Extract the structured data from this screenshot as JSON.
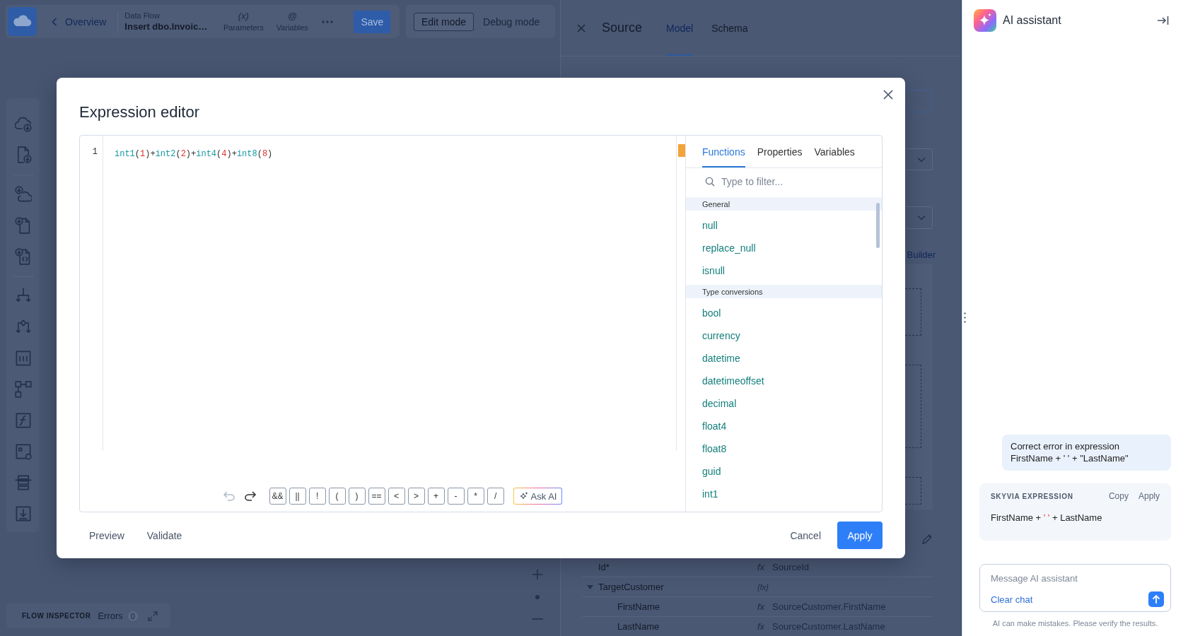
{
  "top_bar": {
    "back_link": "Overview",
    "flow_type": "Data Flow",
    "flow_name": "Insert dbo.Invoic…",
    "tools": [
      {
        "glyph": "(x)",
        "label": "Parameters"
      },
      {
        "glyph": "@",
        "label": "Variables"
      }
    ],
    "save_button": "Save",
    "modes": [
      {
        "label": "Edit mode",
        "selected": true
      },
      {
        "label": "Debug mode",
        "selected": false
      }
    ]
  },
  "flow_inspector": {
    "title": "FLOW INSPECTOR",
    "errors_label": "Errors",
    "errors_count": "0"
  },
  "source_panel": {
    "title": "Source",
    "tabs": [
      {
        "label": "Model",
        "selected": true
      },
      {
        "label": "Schema",
        "selected": false
      }
    ],
    "builder_link": "Builder",
    "mappings": [
      {
        "kind": "field",
        "name": "Id*",
        "marker": "fx",
        "expression": "SourceId"
      },
      {
        "kind": "group",
        "name": "TargetCustomer",
        "marker": "{fx}",
        "expanded": true,
        "children": [
          {
            "kind": "field",
            "name": "FirstName",
            "marker": "fx",
            "expression": "SourceCustomer.FirstName"
          },
          {
            "kind": "field",
            "name": "LastName",
            "marker": "fx",
            "expression": "SourceCustomer.LastName"
          }
        ]
      }
    ]
  },
  "expression_editor": {
    "title": "Expression editor",
    "line_numbers": [
      "1"
    ],
    "code_tokens": [
      {
        "kind": "function",
        "text": "int1"
      },
      {
        "kind": "paren",
        "text": "("
      },
      {
        "kind": "number",
        "text": "1"
      },
      {
        "kind": "paren",
        "text": ")"
      },
      {
        "kind": "operator",
        "text": "+"
      },
      {
        "kind": "function",
        "text": "int2"
      },
      {
        "kind": "paren",
        "text": "("
      },
      {
        "kind": "number",
        "text": "2"
      },
      {
        "kind": "paren",
        "text": ")"
      },
      {
        "kind": "operator",
        "text": "+"
      },
      {
        "kind": "function",
        "text": "int4"
      },
      {
        "kind": "paren",
        "text": "("
      },
      {
        "kind": "number",
        "text": "4"
      },
      {
        "kind": "paren",
        "text": ")"
      },
      {
        "kind": "operator",
        "text": "+"
      },
      {
        "kind": "function",
        "text": "int8"
      },
      {
        "kind": "paren",
        "text": "("
      },
      {
        "kind": "number",
        "text": "8"
      },
      {
        "kind": "paren",
        "text": ")"
      }
    ],
    "history": [
      {
        "kind": "undo",
        "disabled": true
      },
      {
        "kind": "redo",
        "disabled": false
      }
    ],
    "operators": [
      "&&",
      "||",
      "!",
      "(",
      ")",
      "==",
      "<",
      ">",
      "+",
      "-",
      "*",
      "/"
    ],
    "ask_ai": "Ask AI",
    "tabs": [
      {
        "label": "Functions",
        "selected": true
      },
      {
        "label": "Properties",
        "selected": false
      },
      {
        "label": "Variables",
        "selected": false
      }
    ],
    "filter": {
      "placeholder": "Type to filter..."
    },
    "function_groups": [
      {
        "name": "General",
        "items": [
          "null",
          "replace_null",
          "isnull"
        ]
      },
      {
        "name": "Type conversions",
        "items": [
          "bool",
          "currency",
          "datetime",
          "datetimeoffset",
          "decimal",
          "float4",
          "float8",
          "guid",
          "int1"
        ]
      }
    ],
    "footer_actions": [
      "Preview",
      "Validate"
    ],
    "cancel": "Cancel",
    "apply": "Apply"
  },
  "ai_assistant": {
    "title": "AI assistant",
    "messages": [
      {
        "kind": "user",
        "text": "Correct error in expression\nFirstName + ' ' + \"LastName\""
      },
      {
        "kind": "expression",
        "label": "SKYVIA EXPRESSION",
        "actions": [
          "Copy",
          "Apply"
        ],
        "tokens": [
          {
            "kind": "plain",
            "text": "FirstName + "
          },
          {
            "kind": "string",
            "text": "' '"
          },
          {
            "kind": "plain",
            "text": " + LastName"
          }
        ]
      }
    ],
    "input": {
      "placeholder": "Message AI assistant"
    },
    "clear_chat": "Clear chat",
    "disclaimer": "AI can make mistakes. Please verify the results."
  }
}
